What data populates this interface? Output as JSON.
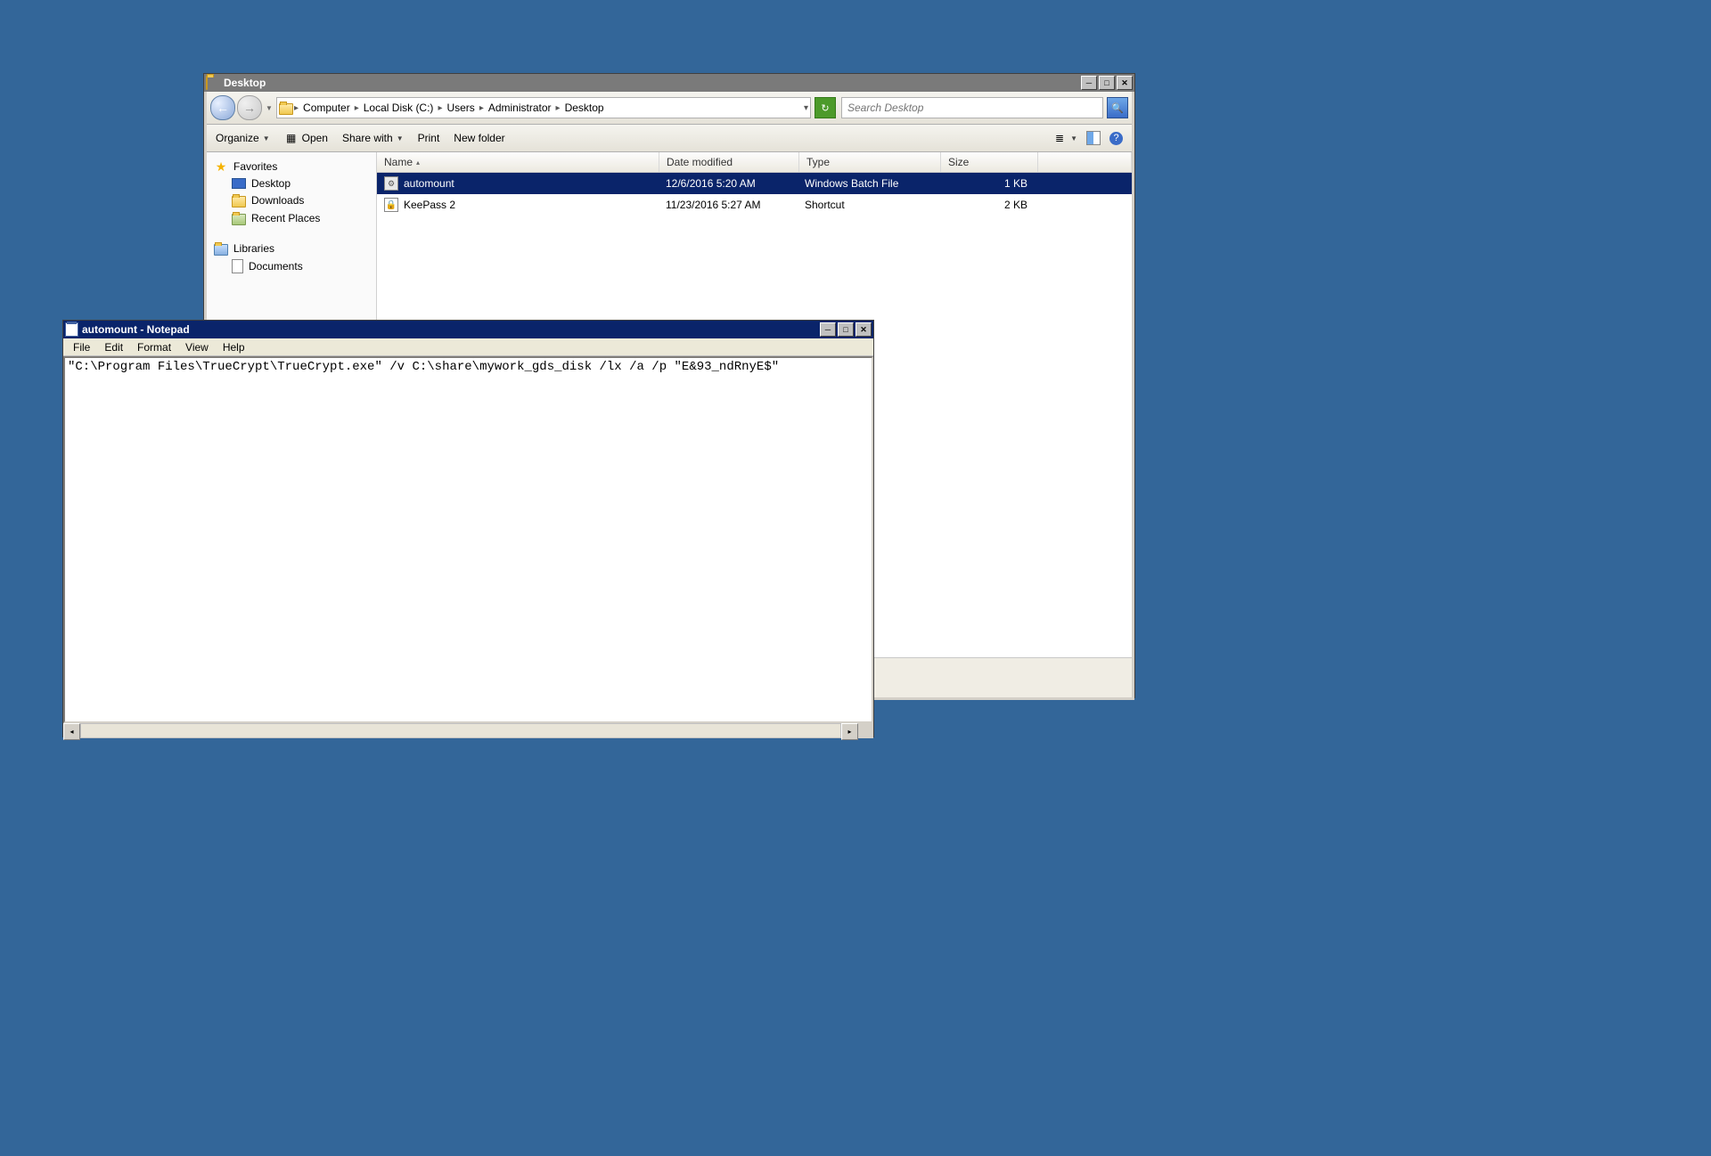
{
  "explorer": {
    "title": "Desktop",
    "breadcrumbs": [
      "Computer",
      "Local Disk (C:)",
      "Users",
      "Administrator",
      "Desktop"
    ],
    "search_placeholder": "Search Desktop",
    "toolbar": {
      "organize": "Organize",
      "open": "Open",
      "share": "Share with",
      "print": "Print",
      "newfolder": "New folder"
    },
    "sidebar": {
      "favorites": "Favorites",
      "fav_items": [
        "Desktop",
        "Downloads",
        "Recent Places"
      ],
      "libraries": "Libraries",
      "lib_items": [
        "Documents"
      ]
    },
    "columns": {
      "name": "Name",
      "date": "Date modified",
      "type": "Type",
      "size": "Size"
    },
    "files": [
      {
        "name": "automount",
        "date": "12/6/2016 5:20 AM",
        "type": "Windows Batch File",
        "size": "1 KB",
        "selected": true,
        "icon": "gear"
      },
      {
        "name": "KeePass 2",
        "date": "11/23/2016 5:27 AM",
        "type": "Shortcut",
        "size": "2 KB",
        "selected": false,
        "icon": "keepass"
      }
    ]
  },
  "notepad": {
    "title": "automount - Notepad",
    "menus": [
      "File",
      "Edit",
      "Format",
      "View",
      "Help"
    ],
    "content": "\"C:\\Program Files\\TrueCrypt\\TrueCrypt.exe\" /v C:\\share\\mywork_gds_disk /lx /a /p \"E&93_ndRnyE$\""
  }
}
